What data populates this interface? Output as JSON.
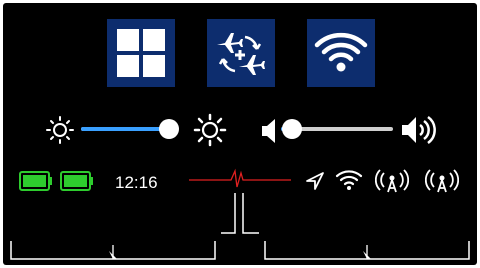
{
  "status_bar": {
    "time": "12:16",
    "battery_count": 2
  },
  "quick_tiles": [
    {
      "name": "windows-grid",
      "icon": "windows-grid-icon"
    },
    {
      "name": "airplane-sync",
      "icon": "airplane-sync-icon"
    },
    {
      "name": "wifi",
      "icon": "wifi-icon"
    }
  ],
  "brightness": {
    "level": 0.92,
    "icon_low": "sun-small-icon",
    "icon_high": "sun-large-icon"
  },
  "volume": {
    "level": 0.1,
    "icon_low": "speaker-low-icon",
    "icon_high": "speaker-high-icon"
  },
  "status_icons": [
    "location-arrow-icon",
    "wifi-small-icon",
    "signal-tower-icon",
    "signal-tower-icon"
  ],
  "colors": {
    "tile_bg": "#0d2d6e",
    "slider_fill": "#3aa0ff",
    "slider_track": "#cfcfcf",
    "battery_green": "#2ecc2e",
    "spike_red": "#e02020"
  }
}
